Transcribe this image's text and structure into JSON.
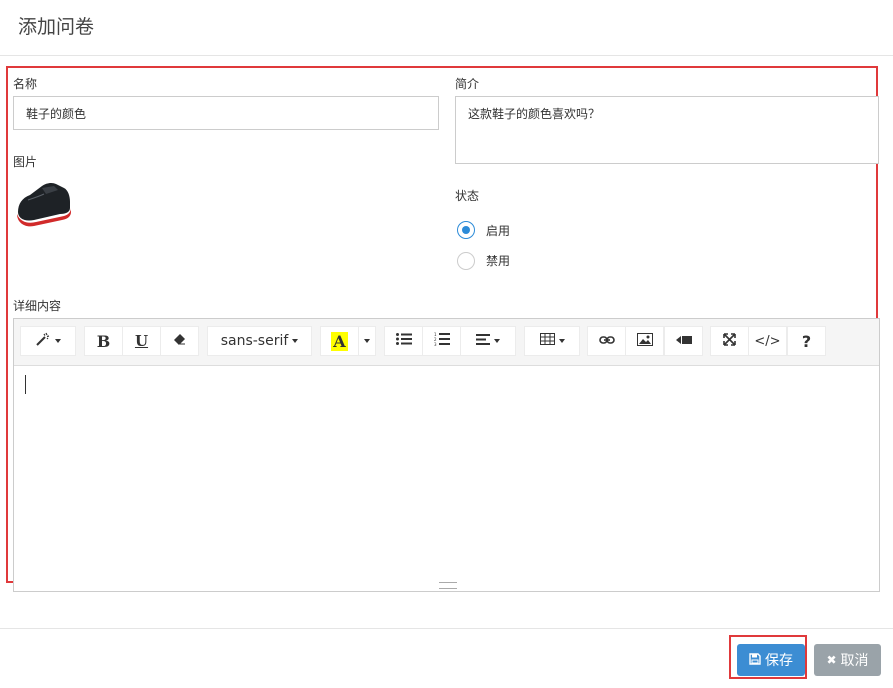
{
  "header": {
    "title": "添加问卷"
  },
  "form": {
    "name_label": "名称",
    "name_value": "鞋子的颜色",
    "image_label": "图片",
    "intro_label": "简介",
    "intro_value": "这款鞋子的颜色喜欢吗？",
    "status_label": "状态",
    "status_options": [
      {
        "label": "启用",
        "checked": true
      },
      {
        "label": "禁用",
        "checked": false
      }
    ],
    "detail_label": "详细内容"
  },
  "editor": {
    "font_name": "sans-serif",
    "toolbar_icons": [
      "magic-icon",
      "bold-icon",
      "underline-icon",
      "eraser-icon",
      "font-name-dropdown",
      "font-color-icon",
      "color-dropdown-icon",
      "unordered-list-icon",
      "ordered-list-icon",
      "align-icon",
      "table-icon",
      "link-icon",
      "picture-icon",
      "video-icon",
      "fullscreen-icon",
      "code-view-icon",
      "help-icon"
    ],
    "bold_glyph": "B",
    "underline_glyph": "U",
    "color_glyph": "A",
    "code_glyph": "</>",
    "help_glyph": "?"
  },
  "footer": {
    "save_label": "保存",
    "cancel_label": "取消"
  },
  "colors": {
    "primary": "#3c8dd3",
    "highlight_frame": "#e0393b",
    "cancel": "#9aa3a9"
  }
}
